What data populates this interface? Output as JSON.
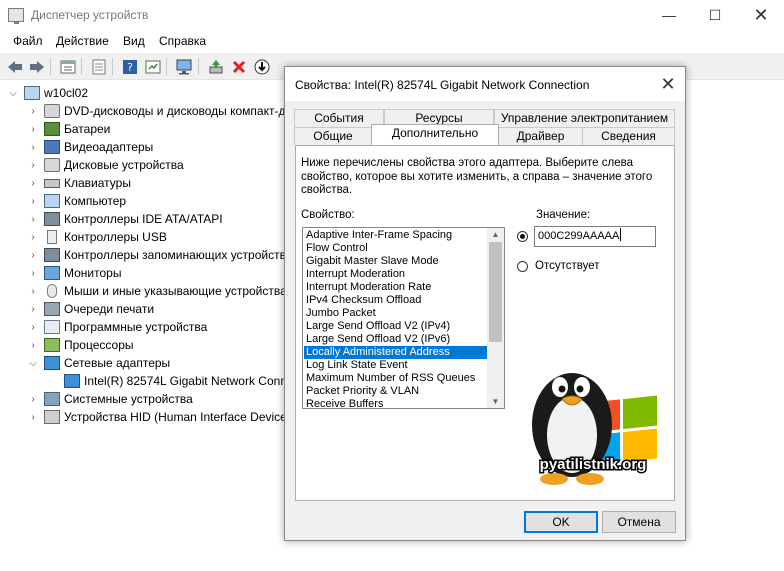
{
  "window": {
    "title": "Диспетчер устройств",
    "controls": {
      "minimize": "—",
      "maximize": "☐",
      "close": "✕"
    }
  },
  "menu": [
    "Файл",
    "Действие",
    "Вид",
    "Справка"
  ],
  "toolbar": {
    "icons": [
      "back-arrow-icon",
      "forward-arrow-icon",
      "properties-icon",
      "list-icon",
      "help-icon",
      "view-icon",
      "monitor-icon",
      "update-driver-icon",
      "uninstall-icon",
      "download-icon"
    ],
    "uninstall_color": "#e02020"
  },
  "tree": {
    "root": {
      "expander": "⌵",
      "label": "w10cl02"
    },
    "items": [
      {
        "expander": "›",
        "label": "DVD-дисководы и дисководы компакт-д",
        "icon": "dvd-drive-icon"
      },
      {
        "expander": "›",
        "label": "Батареи",
        "icon": "battery-icon"
      },
      {
        "expander": "›",
        "label": "Видеоадаптеры",
        "icon": "display-adapter-icon"
      },
      {
        "expander": "›",
        "label": "Дисковые устройства",
        "icon": "disk-drive-icon"
      },
      {
        "expander": "›",
        "label": "Клавиатуры",
        "icon": "keyboard-icon"
      },
      {
        "expander": "›",
        "label": "Компьютер",
        "icon": "computer-icon"
      },
      {
        "expander": "›",
        "label": "Контроллеры IDE ATA/ATAPI",
        "icon": "ide-controller-icon"
      },
      {
        "expander": "›",
        "label": "Контроллеры USB",
        "icon": "usb-icon"
      },
      {
        "expander": "›",
        "label": "Контроллеры запоминающих устройств",
        "icon": "storage-controller-icon"
      },
      {
        "expander": "›",
        "label": "Мониторы",
        "icon": "monitor-icon"
      },
      {
        "expander": "›",
        "label": "Мыши и иные указывающие устройства",
        "icon": "mouse-icon"
      },
      {
        "expander": "›",
        "label": "Очереди печати",
        "icon": "printer-icon"
      },
      {
        "expander": "›",
        "label": "Программные устройства",
        "icon": "software-device-icon"
      },
      {
        "expander": "›",
        "label": "Процессоры",
        "icon": "processor-icon"
      },
      {
        "expander": "⌵",
        "label": "Сетевые адаптеры",
        "icon": "network-adapter-icon"
      },
      {
        "expander": "",
        "label": "Intel(R) 82574L Gigabit Network Conne",
        "icon": "network-adapter-icon"
      },
      {
        "expander": "›",
        "label": "Системные устройства",
        "icon": "system-device-icon"
      },
      {
        "expander": "›",
        "label": "Устройства HID (Human Interface Devices",
        "icon": "hid-icon"
      }
    ]
  },
  "dialog": {
    "title": "Свойства: Intel(R) 82574L Gigabit Network Connection",
    "close": "✕",
    "tabs_top": [
      "События",
      "Ресурсы",
      "Управление электропитанием"
    ],
    "tabs_bottom": [
      "Общие",
      "Дополнительно",
      "Драйвер",
      "Сведения"
    ],
    "active_tab": "Дополнительно",
    "description": "Ниже перечислены свойства этого адаптера. Выберите слева свойство, которое вы хотите изменить, а справа – значение этого свойства.",
    "property_label": "Свойство:",
    "value_label": "Значение:",
    "properties": [
      "Adaptive Inter-Frame Spacing",
      "Flow Control",
      "Gigabit Master Slave Mode",
      "Interrupt Moderation",
      "Interrupt Moderation Rate",
      "IPv4 Checksum Offload",
      "Jumbo Packet",
      "Large Send Offload V2 (IPv4)",
      "Large Send Offload V2 (IPv6)",
      "Locally Administered Address",
      "Log Link State Event",
      "Maximum Number of RSS Queues",
      "Packet Priority & VLAN",
      "Receive Buffers"
    ],
    "selected_property": "Locally Administered Address",
    "value": "000C299AAAAA",
    "absent_label": "Отсутствует",
    "value_radio_selected": true,
    "watermark": "pyatilistnik.org",
    "ok": "OK",
    "cancel": "Отмена",
    "colors": {
      "selection": "#0078d7",
      "win_red": "#f25022",
      "win_green": "#7fba00",
      "win_blue": "#00a4ef",
      "win_yellow": "#ffb900"
    }
  }
}
